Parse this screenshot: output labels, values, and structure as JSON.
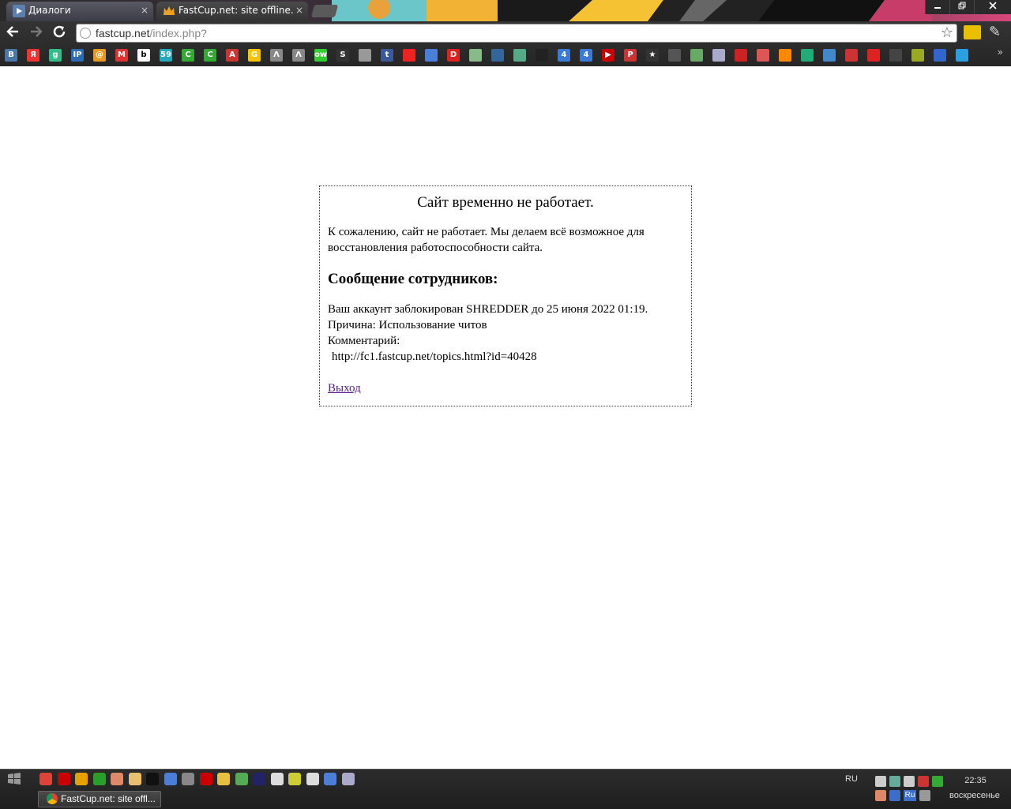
{
  "browser": {
    "tabs": [
      {
        "label": "Диалоги",
        "active": false
      },
      {
        "label": "FastCup.net: site offline.",
        "active": true
      }
    ],
    "close_glyph": "×",
    "url_domain": "fastcup.net",
    "url_path": "/index.php?",
    "bookmark_glyphs": [
      "B",
      "Я",
      "g",
      "IP",
      "@",
      "M",
      "b",
      "59",
      "C",
      "C",
      "A",
      "G",
      "Λ",
      "Λ",
      "ow",
      "S",
      "",
      "t",
      "",
      "",
      "D",
      "",
      "",
      "",
      "",
      "4",
      "4",
      "▶",
      "P",
      "★",
      "",
      "",
      "",
      "",
      "",
      "",
      "",
      "",
      "",
      "",
      "",
      "",
      "",
      "",
      "",
      "",
      ""
    ]
  },
  "page": {
    "title": "Сайт временно не работает.",
    "intro": "К сожалению, сайт не работает. Мы делаем всё возможное для восстановления работоспособности сайта.",
    "staff_heading": "Сообщение сотрудников:",
    "ban_line": "Ваш аккаунт заблокирован SHREDDER до 25 июня 2022 01:19.",
    "reason_line": "Причина: Использование читов",
    "comment_label": "Комментарий:",
    "comment_value": "http://fc1.fastcup.net/topics.html?id=40428",
    "exit_link": "Выход"
  },
  "taskbar": {
    "active_window": "FastCup.net: site offl...",
    "language": "RU",
    "ru_badge": "Ru",
    "time": "22:35",
    "day": "воскресенье"
  },
  "colors": {
    "link_visited": "#551a8b",
    "chrome_bg": "#2f2f2f",
    "accent_pink": "#d9467a"
  }
}
